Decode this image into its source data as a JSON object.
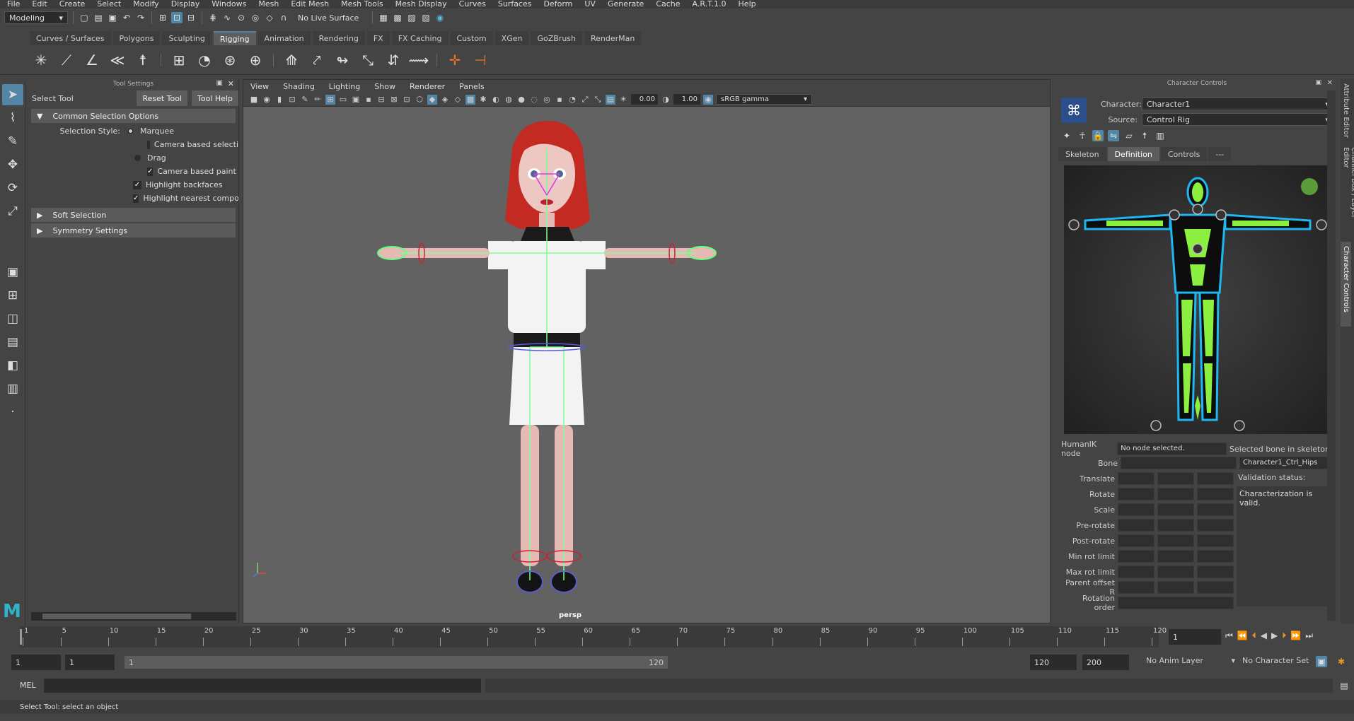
{
  "menubar": [
    "File",
    "Edit",
    "Create",
    "Select",
    "Modify",
    "Display",
    "Windows",
    "Mesh",
    "Edit Mesh",
    "Mesh Tools",
    "Mesh Display",
    "Curves",
    "Surfaces",
    "Deform",
    "UV",
    "Generate",
    "Cache",
    "A.R.T.1.0",
    "Help"
  ],
  "status": {
    "mode": "Modeling",
    "live_surface": "No Live Surface"
  },
  "shelf_tabs": [
    "Curves / Surfaces",
    "Polygons",
    "Sculpting",
    "Rigging",
    "Animation",
    "Rendering",
    "FX",
    "FX Caching",
    "Custom",
    "XGen",
    "GoZBrush",
    "RenderMan"
  ],
  "shelf_active": "Rigging",
  "tool_settings": {
    "panel_title": "Tool Settings",
    "tool_name": "Select Tool",
    "reset_label": "Reset Tool",
    "help_label": "Tool Help",
    "section_common": "Common Selection Options",
    "selection_style_label": "Selection Style:",
    "opt_marquee": "Marquee",
    "opt_camera_select": "Camera based selecti",
    "opt_drag": "Drag",
    "opt_camera_paint": "Camera based paint s",
    "opt_backfaces": "Highlight backfaces",
    "opt_nearest": "Highlight nearest compo",
    "section_soft": "Soft Selection",
    "section_symmetry": "Symmetry Settings"
  },
  "viewport": {
    "menus": [
      "View",
      "Shading",
      "Lighting",
      "Show",
      "Renderer",
      "Panels"
    ],
    "exposure": "0.00",
    "gamma": "1.00",
    "color_space": "sRGB gamma",
    "camera_label": "persp"
  },
  "char_controls": {
    "panel_title": "Character Controls",
    "character_label": "Character:",
    "character_value": "Character1",
    "source_label": "Source:",
    "source_value": "Control Rig",
    "tabs": [
      "Skeleton",
      "Definition",
      "Controls",
      "---"
    ],
    "active_tab": "Definition",
    "hik_node_label": "HumanIK node",
    "hik_node_value": "No node selected.",
    "selected_bone_label": "Selected bone in skeleton",
    "bone_label": "Bone",
    "bone_value": "Character1_Ctrl_Hips",
    "validation_label": "Validation status:",
    "validation_value": "Characterization is valid.",
    "fields": [
      "Translate",
      "Rotate",
      "Scale",
      "Pre-rotate",
      "Post-rotate",
      "Min rot limit",
      "Max rot limit",
      "Parent offset R",
      "Rotation order"
    ],
    "status_color": "#5a9c3a"
  },
  "side_tabs": [
    "Attribute Editor",
    "Channel Box / Layer Editor",
    "Character Controls"
  ],
  "timeline": {
    "ticks": [
      "1",
      "5",
      "10",
      "15",
      "20",
      "25",
      "30",
      "35",
      "40",
      "45",
      "50",
      "55",
      "60",
      "65",
      "70",
      "75",
      "80",
      "85",
      "90",
      "95",
      "100",
      "105",
      "110",
      "115",
      "120"
    ],
    "current_frame": "1"
  },
  "range": {
    "start": "1",
    "playback_start": "1",
    "slider_start": "1",
    "slider_end": "120",
    "playback_end": "120",
    "end": "200",
    "anim_layer": "No Anim Layer",
    "char_set": "No Character Set"
  },
  "cmd": {
    "lang": "MEL"
  },
  "help_text": "Select Tool: select an object"
}
